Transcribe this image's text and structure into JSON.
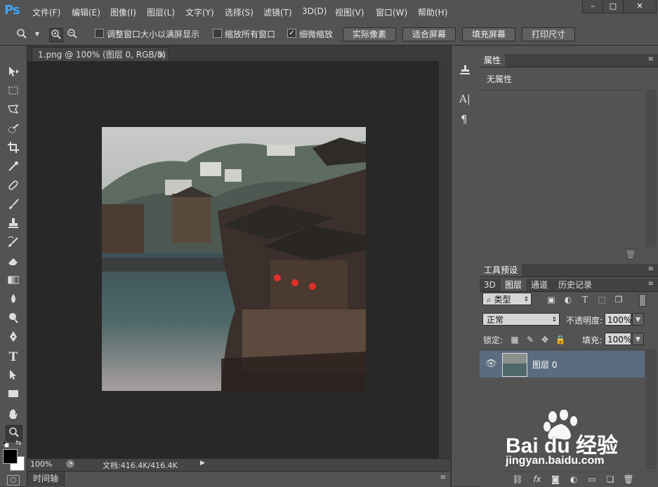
{
  "app": {
    "logo": "Ps",
    "menu": [
      "文件(F)",
      "编辑(E)",
      "图像(I)",
      "图层(L)",
      "文字(Y)",
      "选择(S)",
      "滤镜(T)",
      "3D(D)",
      "视图(V)",
      "窗口(W)",
      "帮助(H)"
    ],
    "window_buttons": [
      "–",
      "□",
      "✕"
    ]
  },
  "options": {
    "chk_resize": {
      "label": "调整窗口大小以满屏显示",
      "checked": false
    },
    "chk_zoom_all": {
      "label": "缩放所有窗口",
      "checked": false
    },
    "chk_scrubby": {
      "label": "细微缩放",
      "checked": true
    },
    "buttons": [
      "实际像素",
      "适合屏幕",
      "填充屏幕",
      "打印尺寸"
    ]
  },
  "document": {
    "tab_title": "1.png @ 100% (图层 0, RGB/8)",
    "tab_close": "×",
    "zoom": "100%",
    "doc_size": "文档:416.4K/416.4K"
  },
  "timeline": {
    "label": "时间轴"
  },
  "properties": {
    "title": "属性",
    "content": "无属性"
  },
  "tool_presets": {
    "title": "工具预设"
  },
  "layers_panel": {
    "tabs": [
      "3D",
      "图层",
      "通道",
      "历史记录"
    ],
    "active_tab": "图层",
    "filter_kind": "类型",
    "blend_mode": "正常",
    "opacity_label": "不透明度:",
    "opacity_value": "100%",
    "lock_label": "锁定:",
    "fill_label": "填充:",
    "fill_value": "100%",
    "layers": [
      {
        "name": "图层 0",
        "visible": true
      }
    ]
  },
  "watermark": {
    "brand": "Bai du 经验",
    "url": "jingyan.baidu.com"
  },
  "colors": {
    "accent": "#3ea6f4",
    "layer_selected": "#5b6c80",
    "panel_bg": "#535353",
    "canvas_bg": "#282828"
  }
}
